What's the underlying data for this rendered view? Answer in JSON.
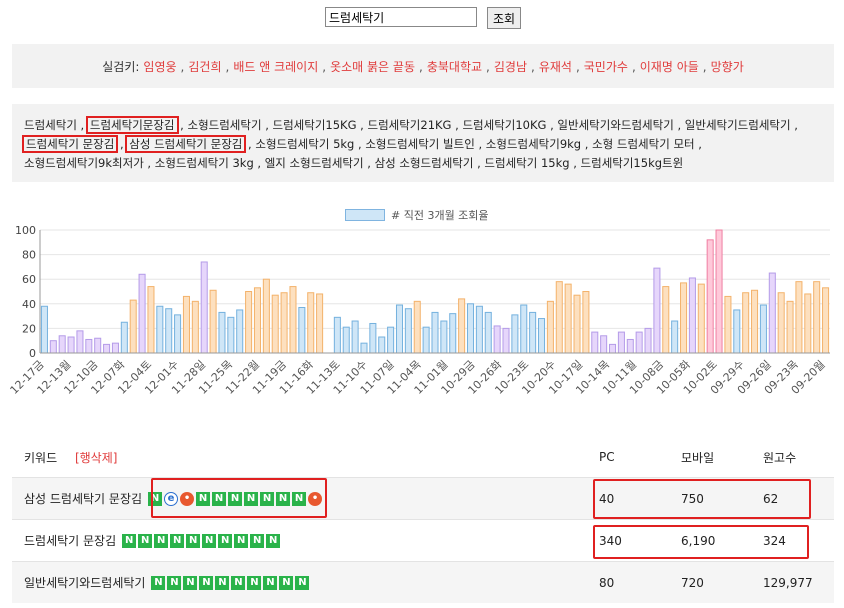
{
  "search": {
    "value": "드럼세탁기",
    "button": "조회"
  },
  "realtime": {
    "label": "실검키:",
    "keywords": [
      "임영웅",
      "김건희",
      "배드 앤 크레이지",
      "옷소매 붉은 끝동",
      "충북대학교",
      "김경남",
      "유재석",
      "국민가수",
      "이재명 아들",
      "망향가"
    ]
  },
  "related": {
    "items": [
      {
        "text": "드럼세탁기",
        "boxed": false
      },
      {
        "text": "드럼세탁기문장김",
        "boxed": true
      },
      {
        "text": "소형드럼세탁기",
        "boxed": false
      },
      {
        "text": "드럼세탁기15KG",
        "boxed": false
      },
      {
        "text": "드럼세탁기21KG",
        "boxed": false
      },
      {
        "text": "드럼세탁기10KG",
        "boxed": false
      },
      {
        "text": "일반세탁기와드럼세탁기",
        "boxed": false
      },
      {
        "text": "일반세탁기드럼세탁기",
        "boxed": false
      },
      {
        "text": "드럼세탁기 문장김",
        "boxed": true
      },
      {
        "text": "삼성 드럼세탁기 문장김",
        "boxed": true
      },
      {
        "text": "소형드럼세탁기 5kg",
        "boxed": false
      },
      {
        "text": "소형드럼세탁기 빌트인",
        "boxed": false
      },
      {
        "text": "소형드럼세탁기9kg",
        "boxed": false
      },
      {
        "text": "소형 드럼세탁기 모터",
        "boxed": false
      },
      {
        "text": "소형드럼세탁기9k최저가",
        "boxed": false
      },
      {
        "text": "소형드럼세탁기 3kg",
        "boxed": false
      },
      {
        "text": "엘지 소형드럼세탁기",
        "boxed": false
      },
      {
        "text": "삼성 소형드럼세탁기",
        "boxed": false
      },
      {
        "text": "드럼세탁기 15kg",
        "boxed": false
      },
      {
        "text": "드럼세탁기15kg트윈",
        "boxed": false
      }
    ]
  },
  "chart_data": {
    "type": "bar",
    "legend": "# 직전 3개월 조회율",
    "ylim": [
      0,
      100
    ],
    "yticks": [
      0,
      20,
      40,
      60,
      80,
      100
    ],
    "xtick_labels": [
      "12-17금",
      "12-13월",
      "12-10금",
      "12-07화",
      "12-04토",
      "12-01수",
      "11-28일",
      "11-25목",
      "11-22월",
      "11-19금",
      "11-16화",
      "11-13토",
      "11-10수",
      "11-07일",
      "11-04목",
      "11-01월",
      "10-29금",
      "10-26화",
      "10-23토",
      "10-20수",
      "10-17일",
      "10-14목",
      "10-11월",
      "10-08금",
      "10-05화",
      "10-02토",
      "09-29수",
      "09-26일",
      "09-23목",
      "09-20월"
    ],
    "values": [
      38,
      10,
      14,
      13,
      18,
      11,
      12,
      7,
      8,
      25,
      43,
      64,
      54,
      38,
      36,
      31,
      46,
      42,
      74,
      51,
      33,
      29,
      35,
      50,
      53,
      60,
      47,
      49,
      54,
      37,
      49,
      48,
      0,
      29,
      21,
      26,
      8,
      24,
      13,
      21,
      39,
      36,
      42,
      21,
      33,
      26,
      32,
      44,
      40,
      38,
      33,
      22,
      20,
      31,
      39,
      33,
      28,
      42,
      58,
      56,
      47,
      50,
      17,
      14,
      7,
      17,
      11,
      17,
      20,
      69,
      54,
      26,
      57,
      61,
      56,
      92,
      100,
      46,
      35,
      49,
      51,
      39,
      65,
      49,
      42,
      58,
      48,
      58,
      53
    ],
    "colors": {
      "blue": "#cfe6f7",
      "blue_edge": "#74b1de",
      "orange": "#fde0bf",
      "orange_edge": "#f3b26b",
      "purple": "#e6d6fb",
      "purple_edge": "#b49be8",
      "pink": "#ffc9da",
      "pink_edge": "#ef7fa2"
    },
    "bar_colors": [
      "b",
      "p",
      "p",
      "p",
      "p",
      "p",
      "p",
      "p",
      "p",
      "b",
      "o",
      "p",
      "o",
      "b",
      "b",
      "b",
      "o",
      "o",
      "p",
      "o",
      "b",
      "b",
      "b",
      "o",
      "o",
      "o",
      "o",
      "o",
      "o",
      "b",
      "o",
      "o",
      "b",
      "b",
      "b",
      "b",
      "b",
      "b",
      "b",
      "b",
      "b",
      "b",
      "o",
      "b",
      "b",
      "b",
      "b",
      "o",
      "b",
      "b",
      "b",
      "p",
      "p",
      "b",
      "b",
      "b",
      "b",
      "o",
      "o",
      "o",
      "o",
      "o",
      "p",
      "p",
      "p",
      "p",
      "p",
      "p",
      "p",
      "p",
      "o",
      "b",
      "o",
      "p",
      "o",
      "k",
      "k",
      "o",
      "b",
      "o",
      "o",
      "b",
      "p",
      "o",
      "o",
      "o",
      "o",
      "o",
      "o"
    ]
  },
  "table": {
    "header": {
      "keyword": "키워드",
      "delete": "[행삭제]",
      "pc": "PC",
      "mobile": "모바일",
      "docs": "원고수"
    },
    "rows": [
      {
        "keyword": "삼성 드럼세탁기 문장김",
        "icons": [
          "N",
          "e",
          "s",
          "N",
          "N",
          "N",
          "N",
          "N",
          "N",
          "N",
          "s"
        ],
        "pc": "40",
        "mobile": "750",
        "docs": "62"
      },
      {
        "keyword": "드럼세탁기 문장김",
        "icons": [
          "N",
          "N",
          "N",
          "N",
          "N",
          "N",
          "N",
          "N",
          "N",
          "N"
        ],
        "pc": "340",
        "mobile": "6,190",
        "docs": "324"
      },
      {
        "keyword": "일반세탁기와드럼세탁기",
        "icons": [
          "N",
          "N",
          "N",
          "N",
          "N",
          "N",
          "N",
          "N",
          "N",
          "N"
        ],
        "pc": "80",
        "mobile": "720",
        "docs": "129,977"
      }
    ]
  }
}
